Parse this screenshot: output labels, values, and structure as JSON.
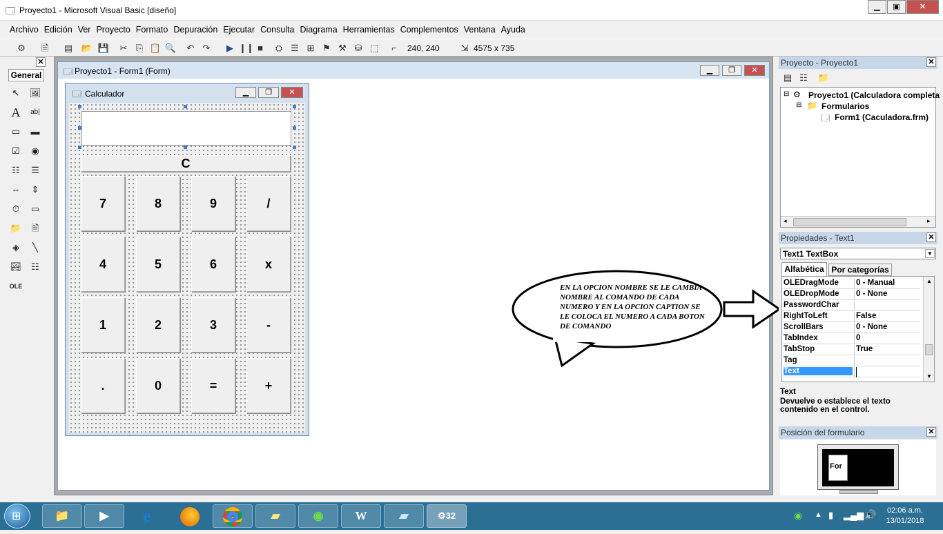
{
  "app": {
    "title": "Proyecto1 - Microsoft Visual Basic [diseño]"
  },
  "menu": [
    "Archivo",
    "Edición",
    "Ver",
    "Proyecto",
    "Formato",
    "Depuración",
    "Ejecutar",
    "Consulta",
    "Diagrama",
    "Herramientas",
    "Complementos",
    "Ventana",
    "Ayuda"
  ],
  "toolbar": {
    "position": "240, 240",
    "size": "4575 x 735"
  },
  "toolbox": {
    "tab": "General"
  },
  "form_window": {
    "title": "Proyecto1 - Form1 (Form)"
  },
  "calculator": {
    "title": "Calculador",
    "clear_label": "C",
    "buttons": [
      [
        "7",
        "8",
        "9",
        "/"
      ],
      [
        "4",
        "5",
        "6",
        "x"
      ],
      [
        "1",
        "2",
        "3",
        "-"
      ],
      [
        ".",
        "0",
        "=",
        "+"
      ]
    ]
  },
  "annotation": "EN LA OPCION NOMBRE SE LE CAMBIA NOMBRE AL COMANDO DE CADA NUMERO Y EN LA OPCION CAPTION SE LE COLOCA EL NUMERO A CADA BOTON DE COMANDO",
  "project": {
    "title": "Proyecto - Proyecto1",
    "root": "Proyecto1 (Calculadora completa",
    "folder": "Formularios",
    "form": "Form1 (Caculadora.frm)"
  },
  "properties": {
    "title": "Propiedades - Text1",
    "object": "Text1 TextBox",
    "tab_alpha": "Alfabética",
    "tab_cat": "Por categorías",
    "rows": [
      [
        "OLEDragMode",
        "0 - Manual"
      ],
      [
        "OLEDropMode",
        "0 - None"
      ],
      [
        "PasswordChar",
        ""
      ],
      [
        "RightToLeft",
        "False"
      ],
      [
        "ScrollBars",
        "0 - None"
      ],
      [
        "TabIndex",
        "0"
      ],
      [
        "TabStop",
        "True"
      ],
      [
        "Tag",
        ""
      ],
      [
        "Text",
        ""
      ]
    ],
    "desc_title": "Text",
    "desc_body": "Devuelve o establece el texto contenido en el control."
  },
  "form_position": {
    "title": "Posición del formulario",
    "label": "For"
  },
  "tray": {
    "time": "02:06 a.m.",
    "date": "13/01/2018"
  }
}
